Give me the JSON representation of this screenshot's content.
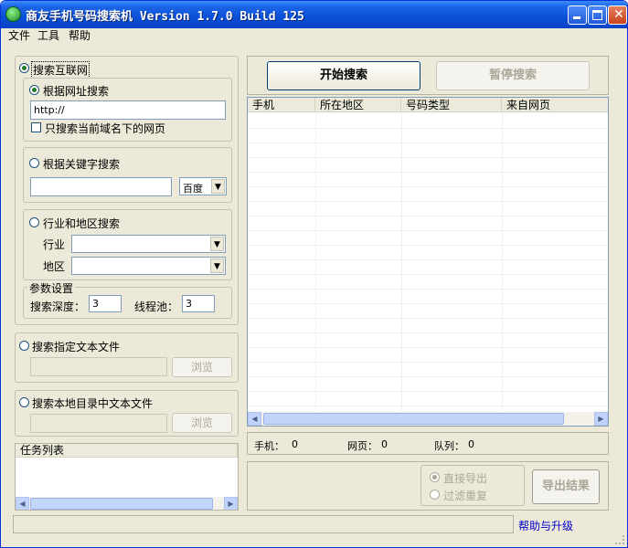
{
  "window": {
    "title": "商友手机号码搜索机 Version 1.7.0 Build 125"
  },
  "menu": [
    "文件",
    "工具",
    "帮助"
  ],
  "left": {
    "internet_search": "搜索互联网",
    "url_search": {
      "label": "根据网址搜索",
      "url_value": "http://",
      "domain_only": "只搜索当前域名下的网页"
    },
    "keyword_search": {
      "label": "根据关键字搜索",
      "keyword_value": "",
      "engine": "百度"
    },
    "industry_search": {
      "label": "行业和地区搜索",
      "industry_label": "行业",
      "region_label": "地区"
    },
    "params": {
      "title": "参数设置",
      "depth_label": "搜索深度：",
      "depth_value": "3",
      "threads_label": "线程池：",
      "threads_value": "3"
    },
    "text_file": {
      "label": "搜索指定文本文件",
      "browse": "浏览"
    },
    "local_dir": {
      "label": "搜索本地目录中文本文件",
      "browse": "浏览"
    },
    "tasks": {
      "title": "任务列表"
    }
  },
  "right": {
    "start": "开始搜索",
    "pause": "暂停搜索",
    "columns": [
      "手机",
      "所在地区",
      "号码类型",
      "来自网页"
    ],
    "stats": {
      "phone_label": "手机：",
      "phone_value": "0",
      "page_label": "网页：",
      "page_value": "0",
      "queue_label": "队列：",
      "queue_value": "0"
    },
    "export": {
      "direct": "直接导出",
      "dedupe": "过滤重复",
      "button": "导出结果"
    }
  },
  "status": {
    "help_link": "帮助与升级"
  }
}
